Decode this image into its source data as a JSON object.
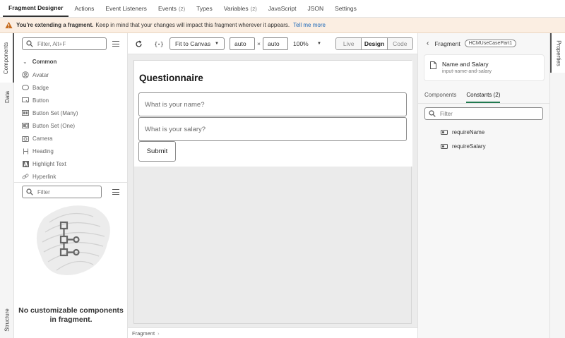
{
  "tabs": [
    {
      "label": "Fragment Designer",
      "count": ""
    },
    {
      "label": "Actions",
      "count": ""
    },
    {
      "label": "Event Listeners",
      "count": ""
    },
    {
      "label": "Events",
      "count": "(2)"
    },
    {
      "label": "Types",
      "count": ""
    },
    {
      "label": "Variables",
      "count": "(2)"
    },
    {
      "label": "JavaScript",
      "count": ""
    },
    {
      "label": "JSON",
      "count": ""
    },
    {
      "label": "Settings",
      "count": ""
    }
  ],
  "banner": {
    "bold": "You're extending a fragment.",
    "text": "Keep in mind that your changes will impact this fragment wherever it appears.",
    "link": "Tell me more"
  },
  "left_rail": {
    "components": "Components",
    "data": "Data",
    "structure": "Structure"
  },
  "components_panel": {
    "filter_placeholder": "Filter, Alt+F",
    "group": "Common",
    "items": [
      "Avatar",
      "Badge",
      "Button",
      "Button Set (Many)",
      "Button Set (One)",
      "Camera",
      "Heading",
      "Highlight Text",
      "Hyperlink"
    ]
  },
  "structure_panel": {
    "filter_placeholder": "Filter",
    "empty_text": "No customizable components in fragment."
  },
  "toolbar": {
    "fit": "Fit to Canvas",
    "width": "auto",
    "times": "×",
    "height": "auto",
    "zoom": "100%",
    "modes": [
      "Live",
      "Design",
      "Code"
    ],
    "active_mode": "Design"
  },
  "canvas": {
    "title": "Questionnaire",
    "name_placeholder": "What is your name?",
    "salary_placeholder": "What is your salary?",
    "submit": "Submit"
  },
  "footer": {
    "breadcrumb": "Fragment"
  },
  "properties": {
    "rail_label": "Properties",
    "header": "Fragment",
    "pill": "HCMUseCasePart1",
    "card_title": "Name and Salary",
    "card_sub": "input-name-and-salary",
    "tab_components": "Components",
    "tab_constants": "Constants (2)",
    "filter_placeholder": "Filter",
    "constants": [
      "requireName",
      "requireSalary"
    ]
  }
}
